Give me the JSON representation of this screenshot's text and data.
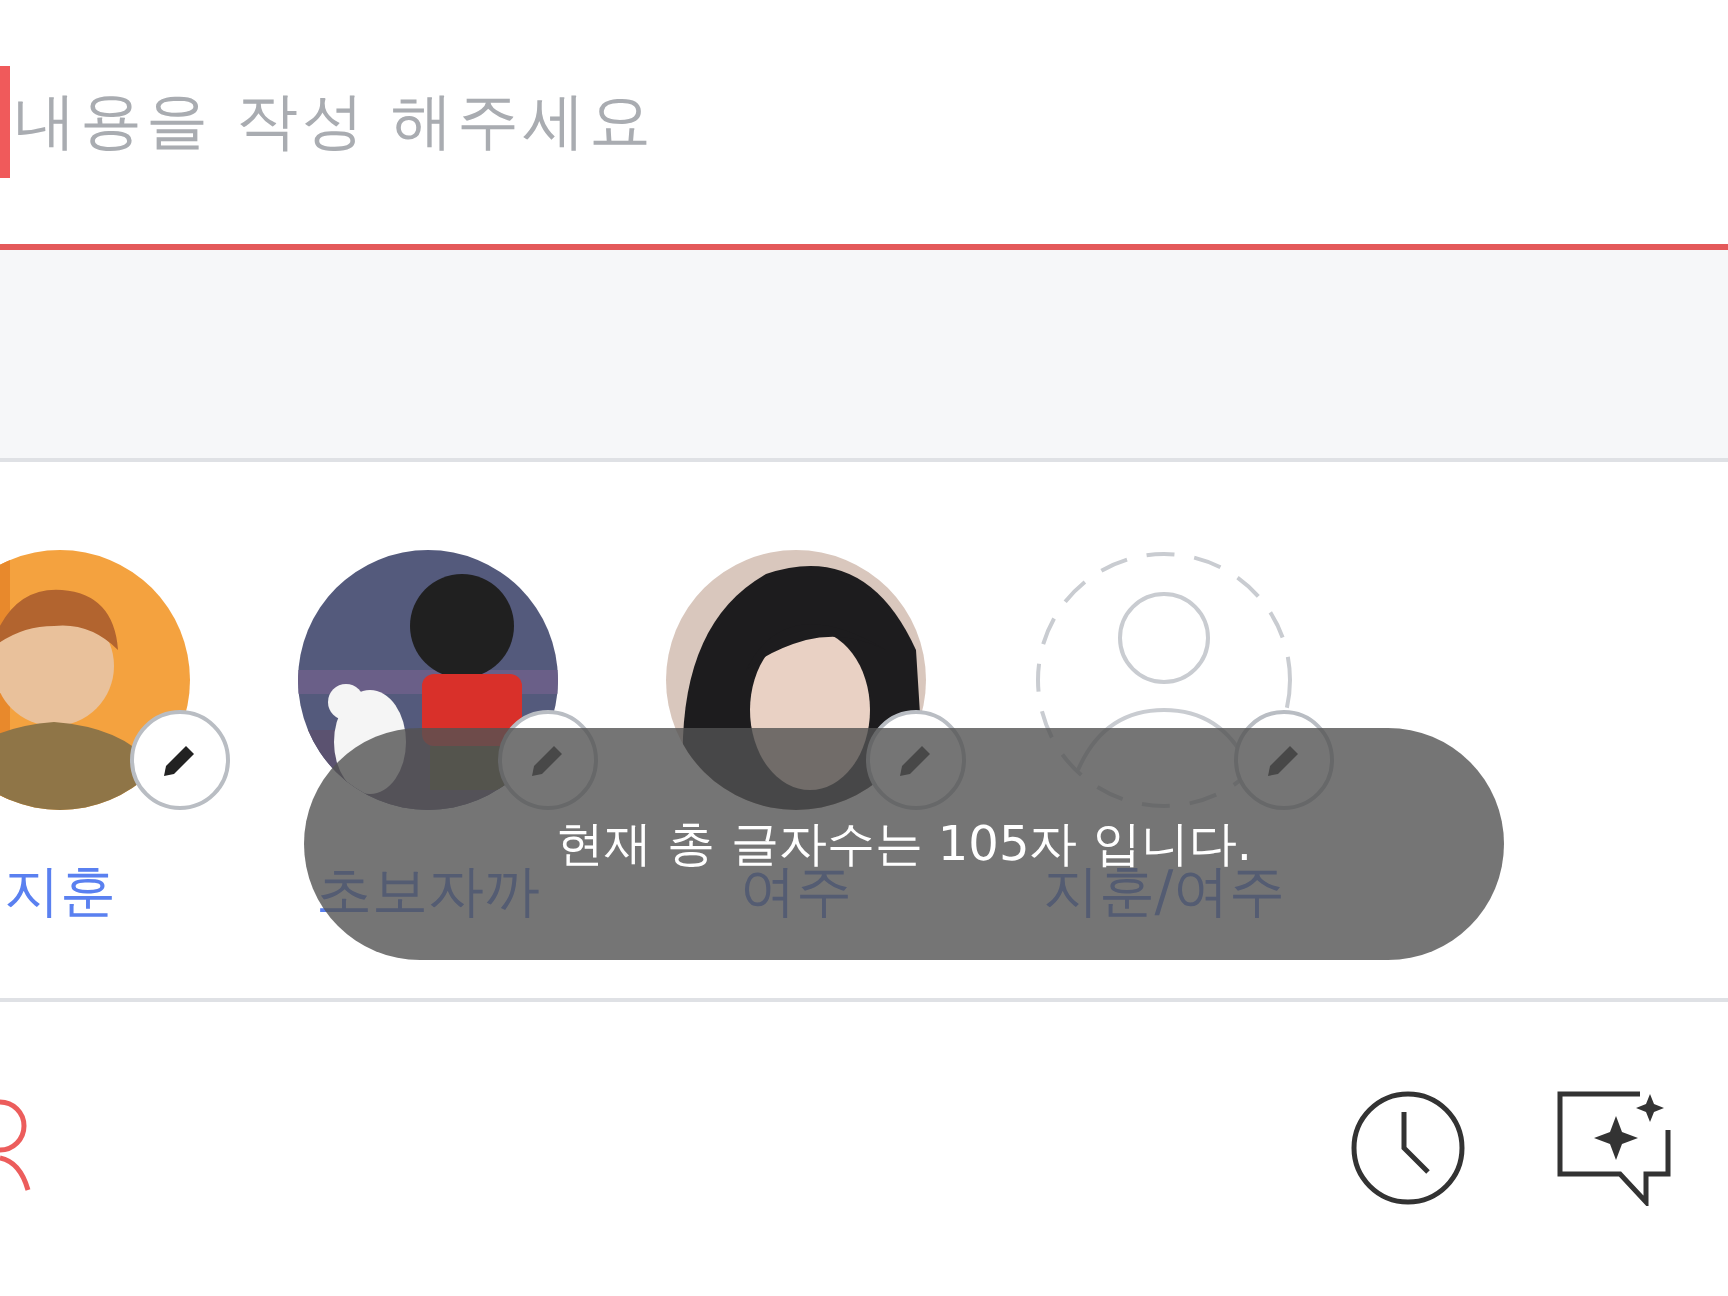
{
  "compose": {
    "placeholder": "내용을 작성 해주세요"
  },
  "members": [
    {
      "name": "지훈"
    },
    {
      "name": "초보자까"
    },
    {
      "name": "여주"
    },
    {
      "name": "지훈/여주",
      "kind": "empty"
    }
  ],
  "toast": {
    "text": "현재 총 글자수는 105자 입니다."
  }
}
